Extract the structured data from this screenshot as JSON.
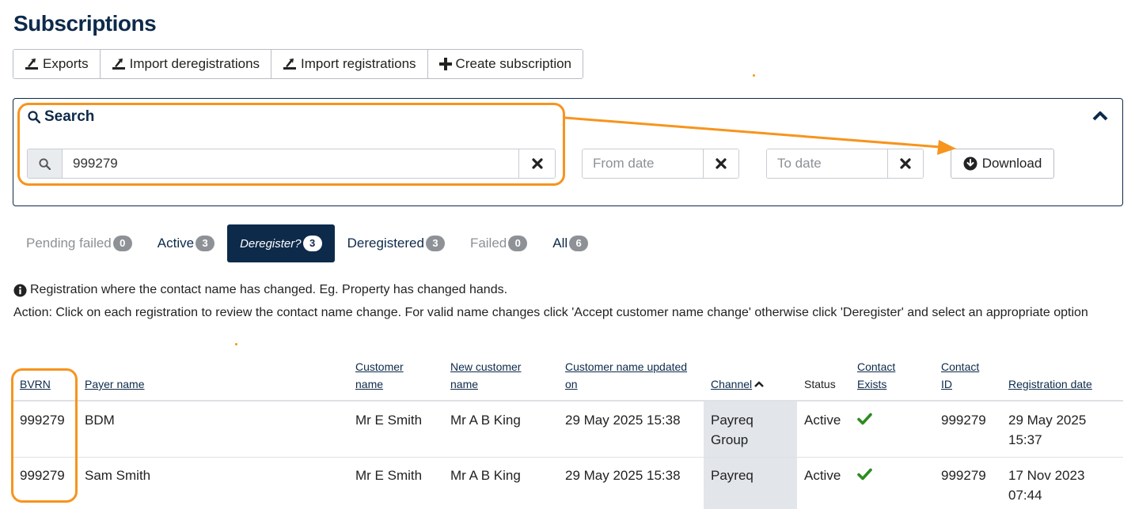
{
  "page": {
    "title": "Subscriptions"
  },
  "toolbar": {
    "exports": "Exports",
    "import_deregistrations": "Import deregistrations",
    "import_registrations": "Import registrations",
    "create_subscription": "Create subscription"
  },
  "search": {
    "title": "Search",
    "query": "999279",
    "from_date_placeholder": "From date",
    "to_date_placeholder": "To date",
    "download_label": "Download"
  },
  "tabs": [
    {
      "label": "Pending failed",
      "count": "0",
      "state": "muted"
    },
    {
      "label": "Active",
      "count": "3",
      "state": "normal"
    },
    {
      "label": "Deregister?",
      "count": "3",
      "state": "active"
    },
    {
      "label": "Deregistered",
      "count": "3",
      "state": "normal"
    },
    {
      "label": "Failed",
      "count": "0",
      "state": "muted"
    },
    {
      "label": "All",
      "count": "6",
      "state": "normal"
    }
  ],
  "info": {
    "line": "Registration where the contact name has changed. Eg. Property has changed hands.",
    "action": "Action: Click on each registration to review the contact name change. For valid name changes click 'Accept customer name change' otherwise click 'Deregister' and select an appropriate option"
  },
  "table": {
    "headers": {
      "bvrn": "BVRN",
      "payer_name": "Payer name",
      "customer_name_1": "Customer",
      "customer_name_2": "name",
      "new_customer_name_1": "New customer",
      "new_customer_name_2": "name",
      "updated_on_1": "Customer name updated",
      "updated_on_2": "on",
      "channel": "Channel",
      "status": "Status",
      "contact_exists_1": "Contact",
      "contact_exists_2": "Exists",
      "contact_id_1": "Contact",
      "contact_id_2": "ID",
      "registration_date": "Registration date"
    },
    "rows": [
      {
        "bvrn": "999279",
        "payer_name": "BDM",
        "customer_name": "Mr E Smith",
        "new_customer_name": "Mr A B King",
        "updated_on": "29 May 2025 15:38",
        "channel_1": "Payreq",
        "channel_2": "Group",
        "status": "Active",
        "contact_exists": "check-icon",
        "contact_id": "999279",
        "registration_date_1": "29 May 2025",
        "registration_date_2": "15:37"
      },
      {
        "bvrn": "999279",
        "payer_name": "Sam Smith",
        "customer_name": "Mr E Smith",
        "new_customer_name": "Mr A B King",
        "updated_on": "29 May 2025 15:38",
        "channel_1": "Payreq",
        "channel_2": "",
        "status": "Active",
        "contact_exists": "check-icon",
        "contact_id": "999279",
        "registration_date_1": "17 Nov 2023",
        "registration_date_2": "07:44"
      }
    ]
  },
  "colors": {
    "brand_navy": "#0d2a4a",
    "annotation_orange": "#f7941d",
    "badge_grey": "#8e9297",
    "check_green": "#2e8b22",
    "channel_column_bg": "#e2e5ea"
  },
  "annotations": {
    "highlight_color": "#f7941d",
    "arrow": "search-to-download"
  }
}
